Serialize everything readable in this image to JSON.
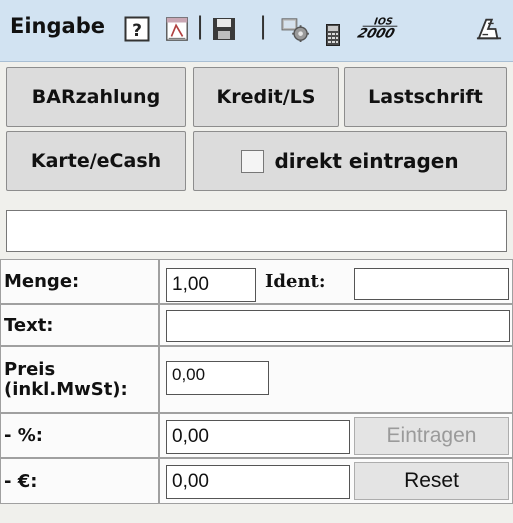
{
  "toolbar": {
    "title": "Eingabe",
    "separator": "|",
    "icons": [
      "help-icon",
      "report-icon",
      "save-icon",
      "settings-icon",
      "calculator-icon",
      "ios2000-icon",
      "exit-icon"
    ]
  },
  "payment_buttons": {
    "bar": "BARzahlung",
    "kredit": "Kredit/LS",
    "lastschrift": "Lastschrift",
    "karte": "Karte/eCash",
    "direkt": "direkt eintragen"
  },
  "direkt_checked": false,
  "search_field": {
    "value": ""
  },
  "form": {
    "menge_label": "Menge:",
    "menge_value": "1,00",
    "ident_label": "Ident:",
    "ident_value": "",
    "text_label": "Text:",
    "text_value": "",
    "preis_label_1": "Preis",
    "preis_label_2": "(inkl.MwSt):",
    "preis_value": "0,00",
    "percent_label": "- %:",
    "percent_value": "0,00",
    "euro_label": "- €:",
    "euro_value": "0,00"
  },
  "actions": {
    "eintragen": "Eintragen",
    "reset": "Reset"
  },
  "colors": {
    "toolbar_bg": "#d2e3f2",
    "button_bg": "#dcdcdc",
    "disabled_text": "#9a9a9a"
  }
}
